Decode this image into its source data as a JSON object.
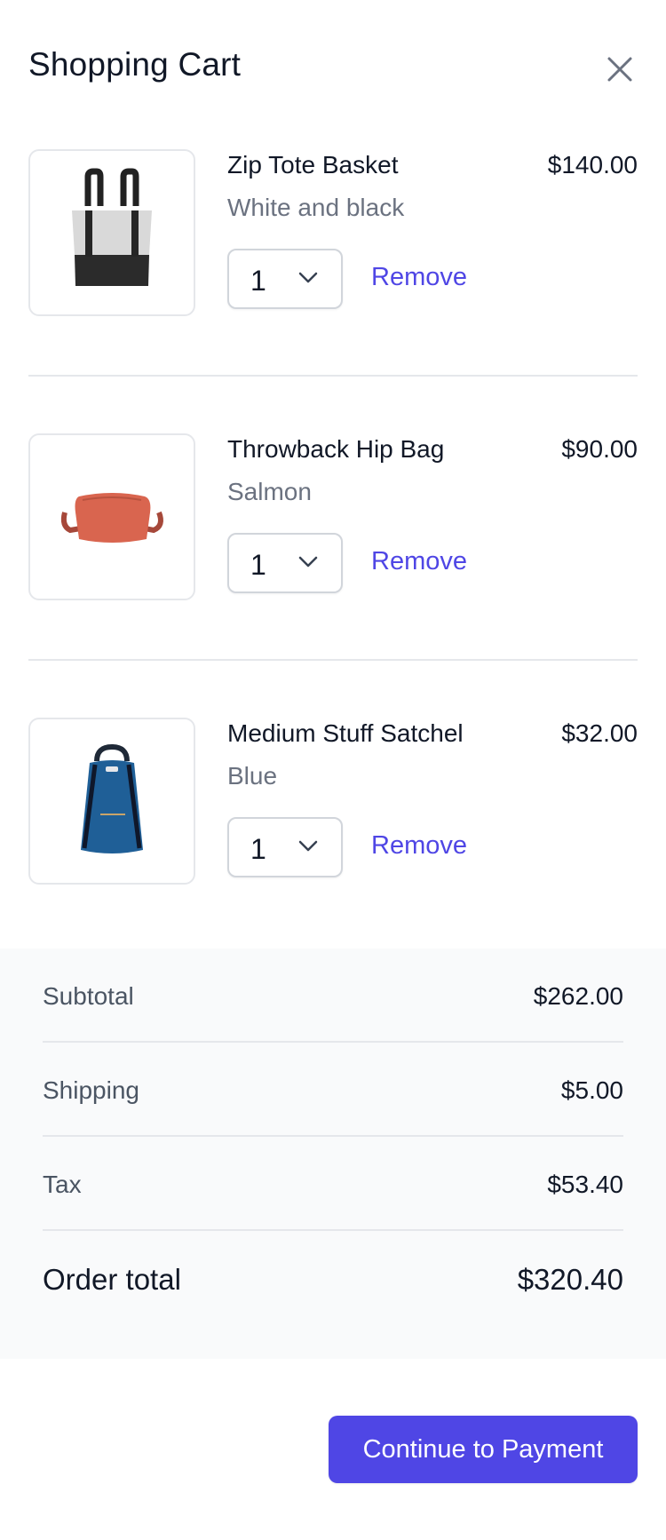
{
  "header": {
    "title": "Shopping Cart",
    "close_icon": "close-icon"
  },
  "cart": {
    "items": [
      {
        "name": "Zip Tote Basket",
        "variant": "White and black",
        "price": "$140.00",
        "quantity": "1",
        "remove_label": "Remove"
      },
      {
        "name": "Throwback Hip Bag",
        "variant": "Salmon",
        "price": "$90.00",
        "quantity": "1",
        "remove_label": "Remove"
      },
      {
        "name": "Medium Stuff Satchel",
        "variant": "Blue",
        "price": "$32.00",
        "quantity": "1",
        "remove_label": "Remove"
      }
    ]
  },
  "summary": {
    "subtotal_label": "Subtotal",
    "subtotal_value": "$262.00",
    "shipping_label": "Shipping",
    "shipping_value": "$5.00",
    "tax_label": "Tax",
    "tax_value": "$53.40",
    "total_label": "Order total",
    "total_value": "$320.40"
  },
  "actions": {
    "continue_label": "Continue to Payment"
  },
  "colors": {
    "accent": "#4f46e5",
    "summary_bg": "#f9fafb",
    "border": "#e5e7eb",
    "muted_text": "#6b7280"
  }
}
